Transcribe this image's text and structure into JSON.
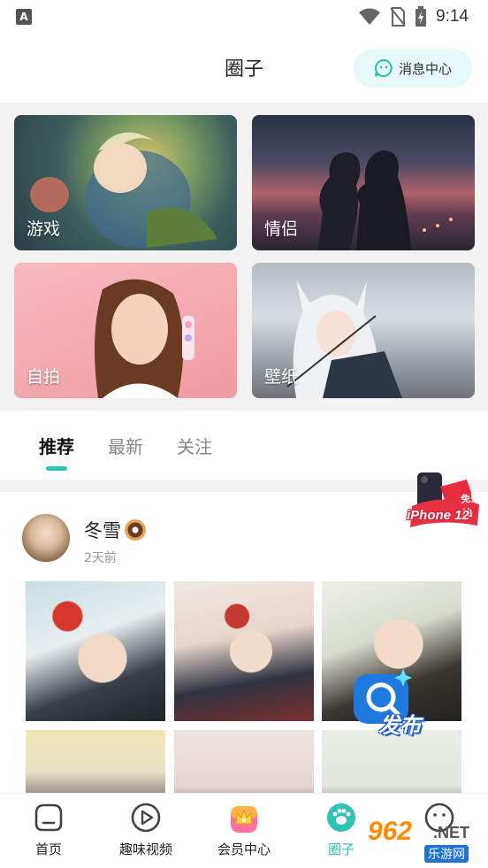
{
  "status_bar": {
    "time": "9:14"
  },
  "header": {
    "title": "圈子",
    "message_center_label": "消息中心"
  },
  "categories": [
    {
      "label": "游戏"
    },
    {
      "label": "情侣"
    },
    {
      "label": "自拍"
    },
    {
      "label": "壁纸"
    }
  ],
  "tabs": [
    {
      "label": "推荐",
      "active": true
    },
    {
      "label": "最新",
      "active": false
    },
    {
      "label": "关注",
      "active": false
    }
  ],
  "post": {
    "author": "冬雪",
    "time": "2天前",
    "photo_count": 6
  },
  "publish_button": {
    "label": "发布"
  },
  "promo": {
    "top_text": "免费抽",
    "text": "iPhone 12"
  },
  "bottom_nav": [
    {
      "label": "首页",
      "icon": "home-icon",
      "active": false
    },
    {
      "label": "趣味视频",
      "icon": "play-icon",
      "active": false
    },
    {
      "label": "会员中心",
      "icon": "crown-icon",
      "active": false
    },
    {
      "label": "圈子",
      "icon": "paw-icon",
      "active": true
    },
    {
      "label": "",
      "icon": "smile-icon",
      "active": false
    }
  ],
  "watermark": {
    "logo": "962",
    "net": ".NET",
    "sub": "乐游网"
  },
  "colors": {
    "accent": "#2fc4b2",
    "message_bg": "#e6f8f7",
    "section_bg": "#f2f2f2"
  }
}
